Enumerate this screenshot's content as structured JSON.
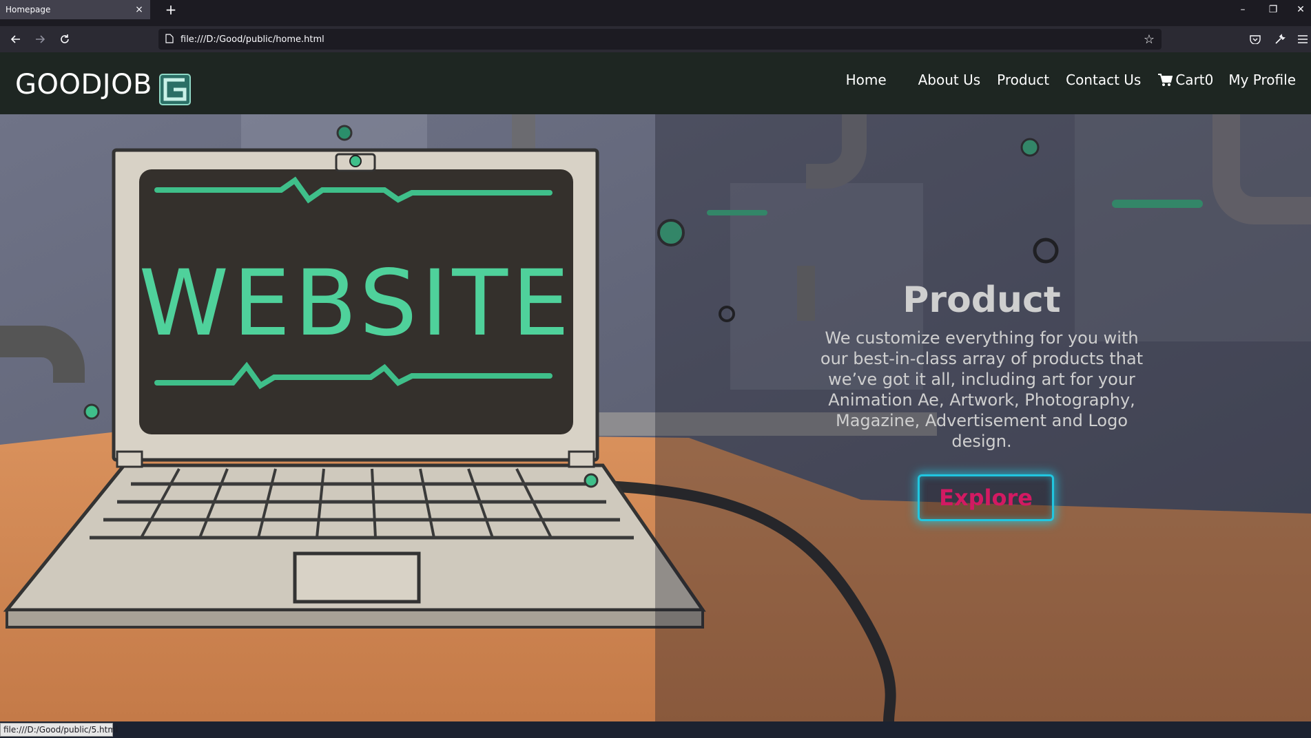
{
  "browser": {
    "tab_title": "Homepage",
    "tab_close": "×",
    "new_tab": "+",
    "url": "file:///D:/Good/public/home.html",
    "status_url": "file:///D:/Good/public/5.html",
    "window_controls": {
      "minimize": "–",
      "restore": "❐",
      "close": "✕"
    },
    "icons": [
      "back-arrow-icon",
      "forward-arrow-icon",
      "reload-icon",
      "page-icon",
      "bookmark-star-icon",
      "pocket-icon",
      "tools-wrench-icon",
      "menu-hamburger-icon"
    ]
  },
  "site": {
    "brand": "GOODJOB",
    "nav": {
      "home": "Home",
      "about": "About Us",
      "product": "Product",
      "contact": "Contact Us",
      "cart": "Cart0",
      "profile": "My Profile"
    }
  },
  "hero": {
    "title": "Product",
    "description": "We customize everything for you with our best-in-class array of products that we’ve got it all, including art for your Animation Ae, Artwork, Photography, Magazine, Advertisement and Logo design.",
    "button": "Explore",
    "screen_text": "WEBSITE"
  },
  "colors": {
    "header_bg": "#1e2622",
    "button_border": "#21c6e0",
    "button_text": "#d21a62",
    "accent_green": "#3fbf8a"
  }
}
